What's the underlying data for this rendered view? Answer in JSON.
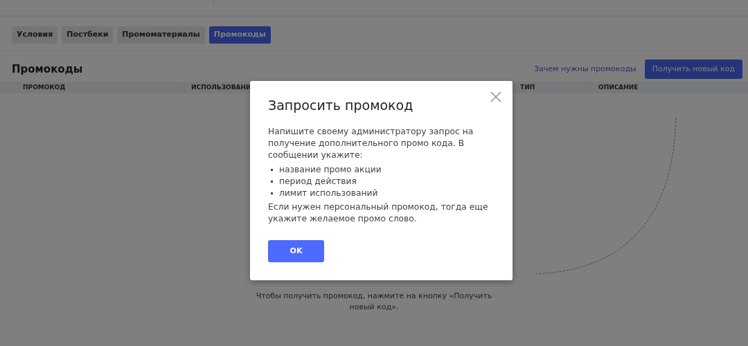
{
  "tabs": [
    {
      "label": "Условия",
      "selected": false
    },
    {
      "label": "Постбеки",
      "selected": false
    },
    {
      "label": "Промоматериалы",
      "selected": false
    },
    {
      "label": "Промокоды",
      "selected": true
    }
  ],
  "section": {
    "title": "Промокоды",
    "help_link": "Зачем нужны промокоды",
    "primary_button": "Получить новый код"
  },
  "table": {
    "columns": [
      "ПРОМОКОД",
      "ИСПОЛЬЗОВАНИ",
      "ТИП",
      "ОПИСАНИЕ"
    ]
  },
  "empty_state": {
    "text": "Чтобы получить промокод, нажмите на кнопку «Получить новый код»."
  },
  "modal": {
    "title": "Запросить промокод",
    "intro": "Напишите своему администратору запрос на получение дополнительного промо кода. В сообщении укажите:",
    "bullets": [
      "название промо акции",
      "период действия",
      "лимит использований"
    ],
    "outro": "Если нужен персональный промокод, тогда еще укажите желаемое промо слово.",
    "ok_button": "OK"
  }
}
